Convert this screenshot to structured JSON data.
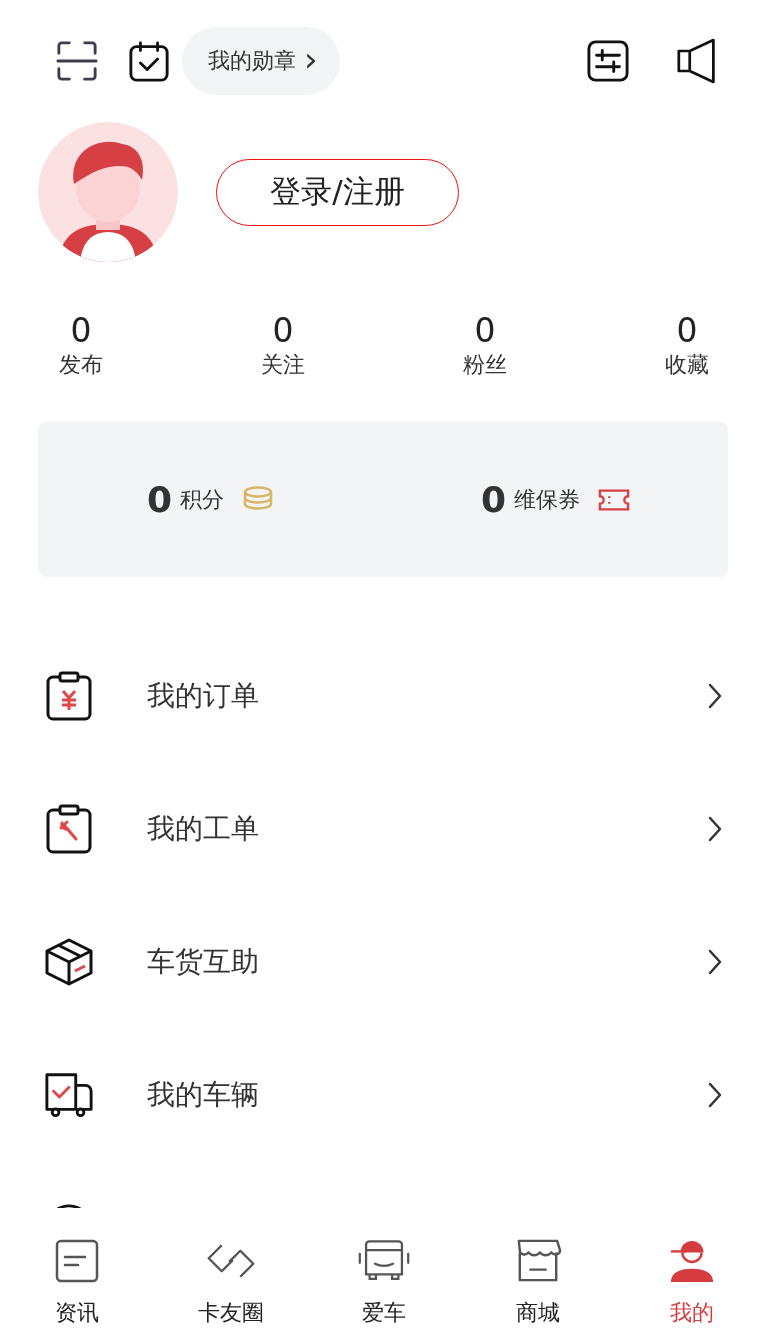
{
  "top_bar": {
    "badge_button": {
      "label": "我的勋章",
      "chevron": "›"
    }
  },
  "login_button": {
    "label": "登录/注册"
  },
  "stats": [
    {
      "value": "0",
      "label": "发布"
    },
    {
      "value": "0",
      "label": "关注"
    },
    {
      "value": "0",
      "label": "粉丝"
    },
    {
      "value": "0",
      "label": "收藏"
    }
  ],
  "wallet": [
    {
      "kind": "points",
      "value": "0",
      "label": "积分"
    },
    {
      "kind": "coupon",
      "value": "0",
      "label": "维保券"
    }
  ],
  "menu": [
    {
      "kind": "order",
      "label": "我的订单"
    },
    {
      "kind": "workorder",
      "label": "我的工单"
    },
    {
      "kind": "parcel",
      "label": "车货互助"
    },
    {
      "kind": "vehicle",
      "label": "我的车辆"
    },
    {
      "kind": "more"
    }
  ],
  "tabs": [
    {
      "kind": "news",
      "label": "资讯",
      "selected": false
    },
    {
      "kind": "circle",
      "label": "卡友圈",
      "selected": false
    },
    {
      "kind": "truck",
      "label": "爱车",
      "selected": false
    },
    {
      "kind": "shop",
      "label": "商城",
      "selected": false
    },
    {
      "kind": "me",
      "label": "我的",
      "selected": true
    }
  ]
}
